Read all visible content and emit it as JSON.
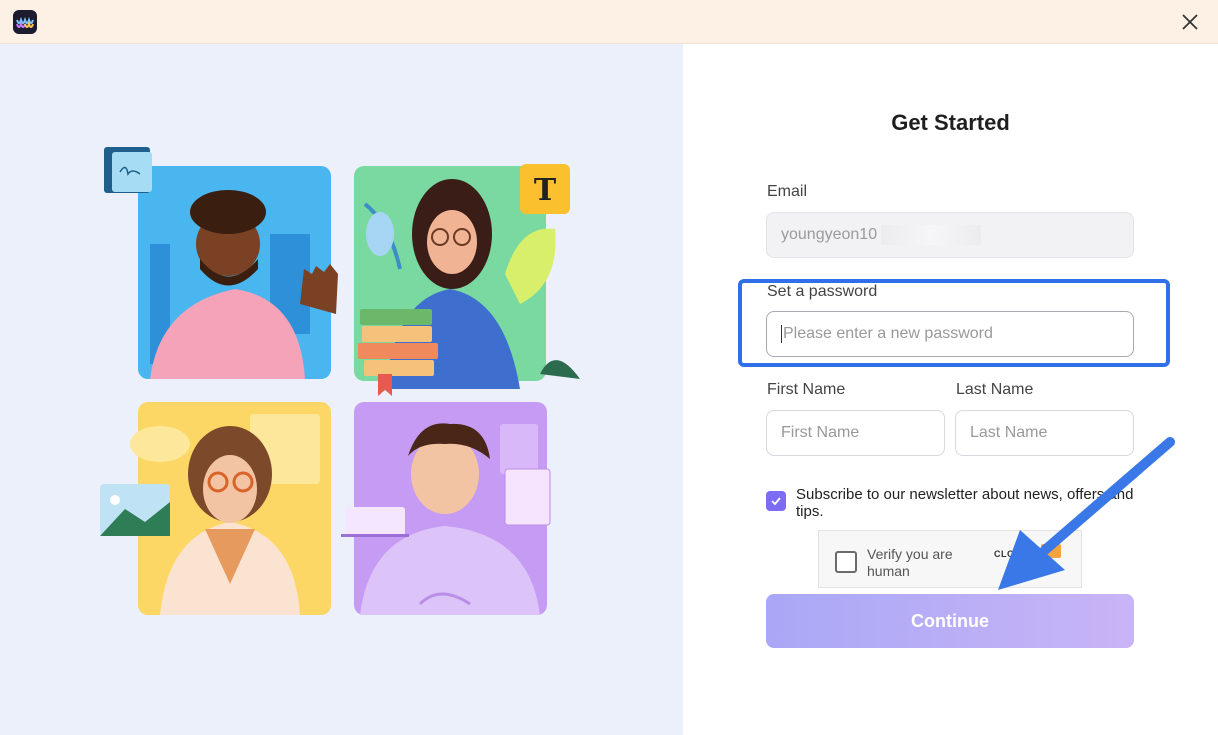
{
  "form": {
    "title": "Get Started",
    "email_label": "Email",
    "email_value": "youngyeon10",
    "password_label": "Set a password",
    "password_placeholder": "Please enter a new password",
    "first_name_label": "First Name",
    "first_name_placeholder": "First Name",
    "last_name_label": "Last Name",
    "last_name_placeholder": "Last Name",
    "subscribe_text": "Subscribe to our newsletter about news, offers and tips.",
    "subscribe_checked": true,
    "captcha_text": "Verify you are human",
    "captcha_brand": "CLOUDFLARE",
    "continue_label": "Continue"
  },
  "colors": {
    "accent": "#7b6cf3",
    "highlight": "#2f6fe8",
    "arrow": "#3a78e8"
  },
  "icons": {
    "app": "app-logo-icon",
    "close": "close-icon"
  }
}
